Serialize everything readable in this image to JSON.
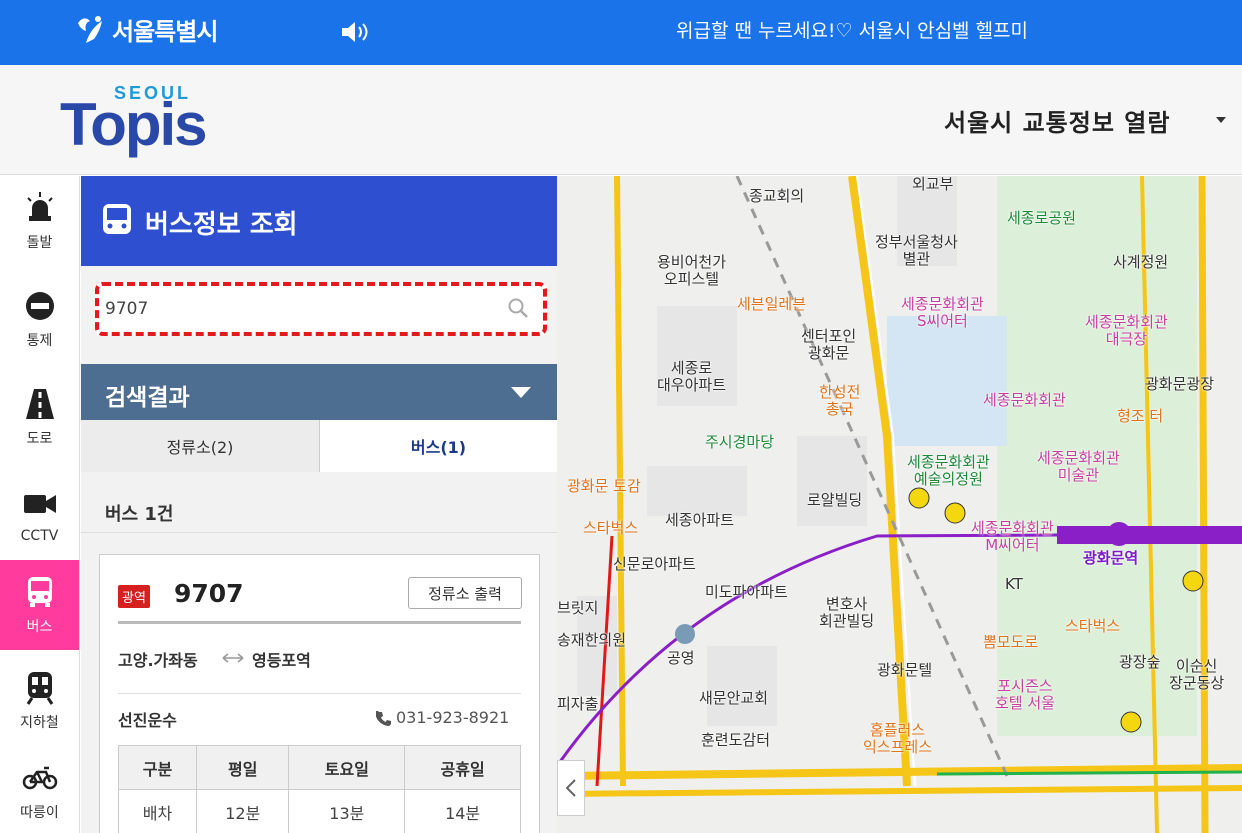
{
  "topbar": {
    "city_name": "서울특별시",
    "notice": "위급할 땐 누르세요!♡ 서울시 안심벨 헬프미"
  },
  "header": {
    "logo_text_top": "SEOUL",
    "logo_text_main": "Topis",
    "title": "서울시 교통정보 열람"
  },
  "leftnav": {
    "items": [
      {
        "label": "돌발",
        "icon": "siren-icon"
      },
      {
        "label": "통제",
        "icon": "no-entry-icon"
      },
      {
        "label": "도로",
        "icon": "road-icon"
      },
      {
        "label": "CCTV",
        "icon": "camera-icon"
      },
      {
        "label": "버스",
        "icon": "bus-icon",
        "active": true
      },
      {
        "label": "지하철",
        "icon": "subway-icon"
      },
      {
        "label": "따릉이",
        "icon": "bicycle-icon"
      }
    ]
  },
  "panel": {
    "title": "버스정보 조회",
    "search": {
      "value": "9707"
    },
    "results_title": "검색결과",
    "tabs": [
      {
        "label": "정류소(2)"
      },
      {
        "label": "버스(1)",
        "active": true
      }
    ],
    "count_text": "버스 1건",
    "bus": {
      "badge": "광역",
      "route_no": "9707",
      "stops_button": "정류소 출력",
      "from": "고양.가좌동",
      "to": "영등포역",
      "company": "선진운수",
      "phone": "031-923-8921",
      "table": {
        "headers": [
          "구분",
          "평일",
          "토요일",
          "공휴일"
        ],
        "rows": [
          [
            "배차",
            "12분",
            "13분",
            "14분"
          ]
        ]
      }
    }
  },
  "map": {
    "labels": [
      {
        "text": "종교회의",
        "style": ""
      },
      {
        "text": "외교부",
        "style": ""
      },
      {
        "text": "세종로공원",
        "style": ""
      },
      {
        "text": "정부서울청사\n별관",
        "style": ""
      },
      {
        "text": "사계정원",
        "style": ""
      },
      {
        "text": "용비어천가\n오피스텔",
        "style": ""
      },
      {
        "text": "세븐일레븐",
        "style": "orange"
      },
      {
        "text": "세종문화회관\nS씨어터",
        "style": "pink"
      },
      {
        "text": "세종문화회관\n대극장",
        "style": "pink"
      },
      {
        "text": "센터포인\n광화문",
        "style": ""
      },
      {
        "text": "세종로\n대우아파트",
        "style": ""
      },
      {
        "text": "한성전\n총국",
        "style": "orange"
      },
      {
        "text": "세종문화회관",
        "style": "pink"
      },
      {
        "text": "광화문광장",
        "style": ""
      },
      {
        "text": "형조 터",
        "style": "orange"
      },
      {
        "text": "주시경마당",
        "style": "green"
      },
      {
        "text": "세종문화회관\n예술의정원",
        "style": "green"
      },
      {
        "text": "세종문화회관\n미술관",
        "style": "pink"
      },
      {
        "text": "광화문 토감",
        "style": "orange"
      },
      {
        "text": "로얄빌딩",
        "style": ""
      },
      {
        "text": "스타벅스",
        "style": "orange"
      },
      {
        "text": "세종아파트",
        "style": ""
      },
      {
        "text": "세종문화회관\nM씨어터",
        "style": "pink"
      },
      {
        "text": "광화문역",
        "style": "purple"
      },
      {
        "text": "신문로아파트",
        "style": ""
      },
      {
        "text": "미도파아파트",
        "style": ""
      },
      {
        "text": "KT",
        "style": ""
      },
      {
        "text": "변호사\n회관빌딩",
        "style": ""
      },
      {
        "text": "뽐모도로",
        "style": "orange"
      },
      {
        "text": "스타벅스",
        "style": "orange"
      },
      {
        "text": "공영",
        "style": ""
      },
      {
        "text": "광화문텔",
        "style": ""
      },
      {
        "text": "광장숲",
        "style": ""
      },
      {
        "text": "이순신\n장군동상",
        "style": ""
      },
      {
        "text": "새문안교회",
        "style": ""
      },
      {
        "text": "포시즌스\n호텔 서울",
        "style": "pink"
      },
      {
        "text": "훈련도감터",
        "style": ""
      },
      {
        "text": "홈플러스\n익스프레스",
        "style": "orange"
      },
      {
        "text": "브릿지",
        "style": ""
      },
      {
        "text": "송재한의원",
        "style": ""
      },
      {
        "text": "피자출",
        "style": ""
      }
    ]
  }
}
